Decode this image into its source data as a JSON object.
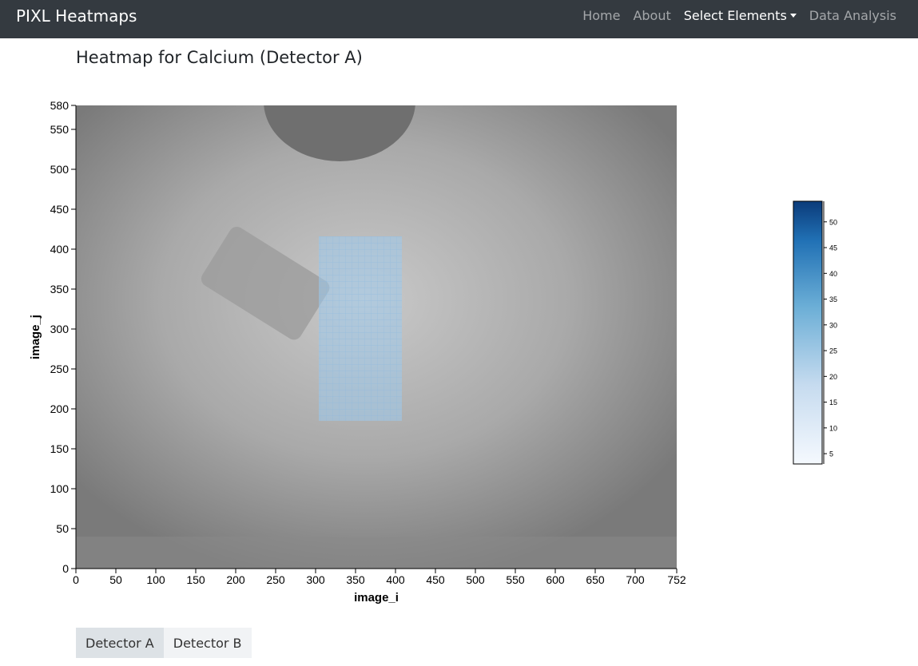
{
  "navbar": {
    "brand": "PIXL Heatmaps",
    "links": {
      "home": "Home",
      "about": "About",
      "select_elements": "Select Elements",
      "data_analysis": "Data Analysis"
    }
  },
  "page_title": "Heatmap for Calcium (Detector A)",
  "detector_buttons": [
    "Detector A",
    "Detector B"
  ],
  "colors": {
    "navbar_bg": "#343a40",
    "accent": "#2a7fc0",
    "colorbar_low": "#f5f9fe",
    "colorbar_high": "#0b3b7a"
  },
  "chart_data": {
    "type": "heatmap",
    "title": "",
    "xlabel": "image_i",
    "ylabel": "image_j",
    "xlim": [
      0,
      752
    ],
    "ylim": [
      0,
      580
    ],
    "xticks": [
      0,
      50,
      100,
      150,
      200,
      250,
      300,
      350,
      400,
      450,
      500,
      550,
      600,
      650,
      700,
      752
    ],
    "yticks": [
      0,
      50,
      100,
      150,
      200,
      250,
      300,
      350,
      400,
      450,
      500,
      550,
      580
    ],
    "heatmap_region": {
      "x": [
        304,
        408
      ],
      "y": [
        185,
        416
      ]
    },
    "colorbar": {
      "min": 3,
      "max": 54,
      "ticks": [
        5,
        10,
        15,
        20,
        25,
        30,
        35,
        40,
        45,
        50
      ],
      "colormap": "Blues"
    },
    "background": "grayscale context image"
  }
}
